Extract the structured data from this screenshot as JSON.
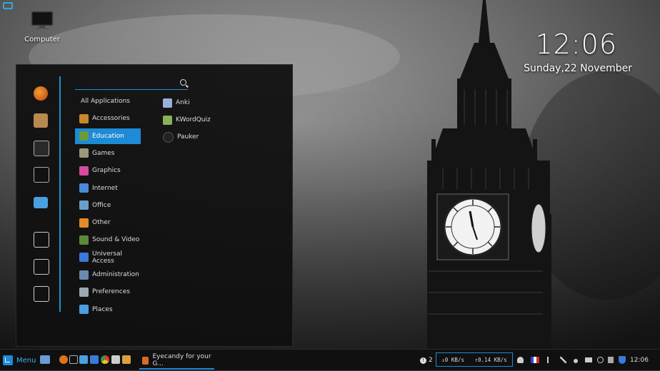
{
  "desktop": {
    "computer_label": "Computer",
    "clock_time": "12:06",
    "clock_date": "Sunday,22 November"
  },
  "menu": {
    "search_placeholder": "",
    "favorites": [
      "firefox-icon",
      "package-icon",
      "settings-icon",
      "terminal-icon",
      "folder-icon",
      "lock-icon",
      "logout-icon",
      "power-icon"
    ],
    "categories": [
      {
        "label": "All Applications",
        "icon": "none"
      },
      {
        "label": "Accessories",
        "icon": "accessories-icon",
        "color": "#c8882a"
      },
      {
        "label": "Education",
        "icon": "education-icon",
        "color": "#6a9a3a",
        "selected": true
      },
      {
        "label": "Games",
        "icon": "games-icon",
        "color": "#9a9a7a"
      },
      {
        "label": "Graphics",
        "icon": "graphics-icon",
        "color": "#d84aa0"
      },
      {
        "label": "Internet",
        "icon": "internet-icon",
        "color": "#4a8ad8"
      },
      {
        "label": "Office",
        "icon": "office-icon",
        "color": "#6aa0c8"
      },
      {
        "label": "Other",
        "icon": "other-icon",
        "color": "#e08a2a"
      },
      {
        "label": "Sound & Video",
        "icon": "sound-video-icon",
        "color": "#5a8a3a"
      },
      {
        "label": "Universal Access",
        "icon": "universal-access-icon",
        "color": "#3a7ad8"
      },
      {
        "label": "Administration",
        "icon": "administration-icon",
        "color": "#6a8ab0"
      },
      {
        "label": "Preferences",
        "icon": "preferences-icon",
        "color": "#9aaab0"
      },
      {
        "label": "Places",
        "icon": "places-icon",
        "color": "#4aa0e0"
      }
    ],
    "apps": [
      {
        "label": "Anki",
        "icon": "anki-icon",
        "color": "#9ab0d8"
      },
      {
        "label": "KWordQuiz",
        "icon": "kwordquiz-icon",
        "color": "#8ab05a"
      },
      {
        "label": "Pauker",
        "icon": "pauker-icon",
        "color": "#222222"
      }
    ]
  },
  "panel": {
    "menu_label": "Menu",
    "task_label": "Eyecandy for your G...",
    "notifications_count": "2",
    "net_down": "↓0 KB/s",
    "net_up": "↑0.14 KB/s",
    "clock": "12:06"
  }
}
